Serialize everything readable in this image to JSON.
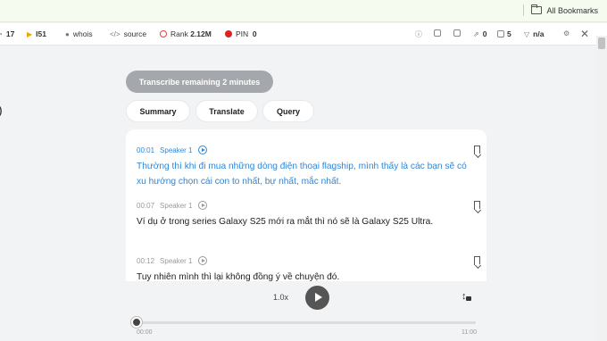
{
  "bookmarks_bar": {
    "all_bookmarks": "All Bookmarks"
  },
  "seo_toolbar": {
    "items": [
      {
        "icon": "gauge-icon",
        "value": "17"
      },
      {
        "icon": "index-icon",
        "value": "I51"
      },
      {
        "icon": "user-icon",
        "label": "whois"
      },
      {
        "icon": "code-icon",
        "label": "source"
      },
      {
        "icon": "rank-icon",
        "label": "Rank",
        "value": "2.12M"
      },
      {
        "icon": "pinterest-icon",
        "label": "PIN",
        "value": "0"
      }
    ],
    "right": {
      "external_links": "0",
      "pages": "5",
      "na": "n/a"
    }
  },
  "transcript": {
    "transcribe_button": "Transcribe remaining 2 minutes",
    "tabs": [
      "Summary",
      "Translate",
      "Query"
    ],
    "segments": [
      {
        "time": "00:01",
        "speaker": "Speaker 1",
        "text": "Thường thì khi đi mua những dòng điện thoại flagship, mình thấy là các bạn sẽ có xu hướng chọn cái con to nhất, bự nhất, mắc nhất.",
        "active": true
      },
      {
        "time": "00:07",
        "speaker": "Speaker 1",
        "text": "Ví dụ ở trong series Galaxy S25 mới ra mắt thì nó sẽ là Galaxy S25 Ultra.",
        "active": false
      },
      {
        "time": "00:12",
        "speaker": "Speaker 1",
        "text": "Tuy nhiên mình thì lại không đồng ý về chuyện đó.",
        "active": false
      }
    ]
  },
  "player": {
    "speed": "1.0x",
    "current_time": "00:00",
    "duration": "11:00",
    "progress": 0
  },
  "colors": {
    "accent": "#2f86d6",
    "button_disabled": "#a4a7ab"
  }
}
